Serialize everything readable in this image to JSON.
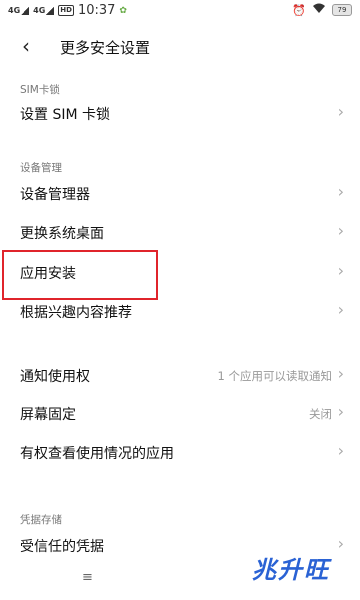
{
  "status_bar": {
    "network1": "4G",
    "network2": "4G",
    "hd_badge": "HD",
    "time": "10:37",
    "battery_label": "79",
    "battery_percent": 79
  },
  "header": {
    "title": "更多安全设置"
  },
  "sections": {
    "sim": {
      "label": "SIM卡锁",
      "rows": [
        {
          "label": "设置 SIM 卡锁"
        }
      ]
    },
    "device": {
      "label": "设备管理",
      "rows": [
        {
          "label": "设备管理器"
        },
        {
          "label": "更换系统桌面"
        },
        {
          "label": "应用安装"
        },
        {
          "label": "根据兴趣内容推荐"
        }
      ]
    },
    "other": {
      "rows": [
        {
          "label": "通知使用权",
          "value": "1 个应用可以读取通知"
        },
        {
          "label": "屏幕固定",
          "value": "关闭"
        },
        {
          "label": "有权查看使用情况的应用"
        }
      ]
    },
    "credentials": {
      "label": "凭据存储",
      "rows": [
        {
          "label": "受信任的凭据"
        }
      ]
    }
  },
  "icons": {
    "back": "‹",
    "chevron": "›",
    "menu": "≡"
  },
  "watermark": "兆升旺",
  "colors": {
    "highlight": "#e0242b",
    "watermark": "#2a62d4"
  }
}
